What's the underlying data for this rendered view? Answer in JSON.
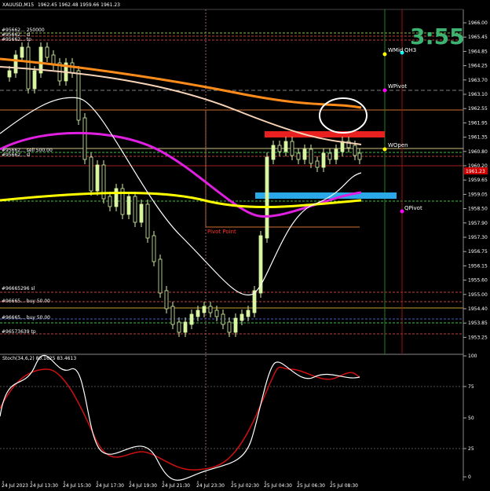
{
  "window": {
    "title": "XAUUSD,M15",
    "quote": "1962.45 1962.48 1959.66 1961.23"
  },
  "clock": {
    "text": "3:55",
    "color": "#3cb371"
  },
  "price_axis": {
    "ticks": [
      "1966.00",
      "1965.45",
      "1964.85",
      "1964.25",
      "1963.70",
      "1963.10",
      "1962.55",
      "1961.95",
      "1961.35",
      "1960.80",
      "1960.20",
      "1959.65",
      "1959.05",
      "1958.50",
      "1957.90",
      "1957.30",
      "1956.75",
      "1956.15",
      "1955.60",
      "1955.00",
      "1954.40",
      "1953.85",
      "1953.25"
    ],
    "current": "1961.23",
    "current_color": "#d00000"
  },
  "stoch": {
    "title": "Stoch(34,6,2) 80.1625 83.4613",
    "ticks": [
      "100",
      "75",
      "50",
      "25",
      "0"
    ]
  },
  "time_axis": [
    "24 Jul 2023",
    "24 Jul 13:30",
    "24 Jul 15:30",
    "24 Jul 17:30",
    "24 Jul 19:30",
    "24 Jul 21:30",
    "24 Jul 23:30",
    "25 Jul 02:30",
    "25 Jul 04:30",
    "25 Jul 06:30",
    "25 Jul 08:30"
  ],
  "pivots": [
    {
      "name": "WMid",
      "color": "#ffff00"
    },
    {
      "name": "QH3",
      "color": "#ffffff"
    },
    {
      "name": "WPivot",
      "color": "#ff00ff"
    },
    {
      "name": "WOpen",
      "color": "#ffff00"
    },
    {
      "name": "QPivot",
      "color": "#ff00ff"
    }
  ],
  "pivot_point": {
    "text": "Pivot Point",
    "color": "#ff3030"
  },
  "order_labels": [
    "#95662... 250000",
    "#95662... sl",
    "#95662... tp",
    "#95662... sell 500.00",
    "#95662... sl",
    "#96665296 sl",
    "#96665... buy 50.00",
    "#96665... buy 50.00",
    "#96573639 tp"
  ],
  "colors": {
    "background": "#000000",
    "candle_up": "#d8f5a2",
    "candle_down": "#000000",
    "ema_orange": "#ff8c1a",
    "ema_peach": "#f7d4b8",
    "ma_magenta": "#e020e0",
    "ma_yellow": "#ffff00",
    "bollinger_white": "#ffffff",
    "stoch_main": "#ffffff",
    "stoch_signal": "#d01010",
    "zone_red": "#e82020",
    "zone_blue": "#2aa8e8"
  }
}
